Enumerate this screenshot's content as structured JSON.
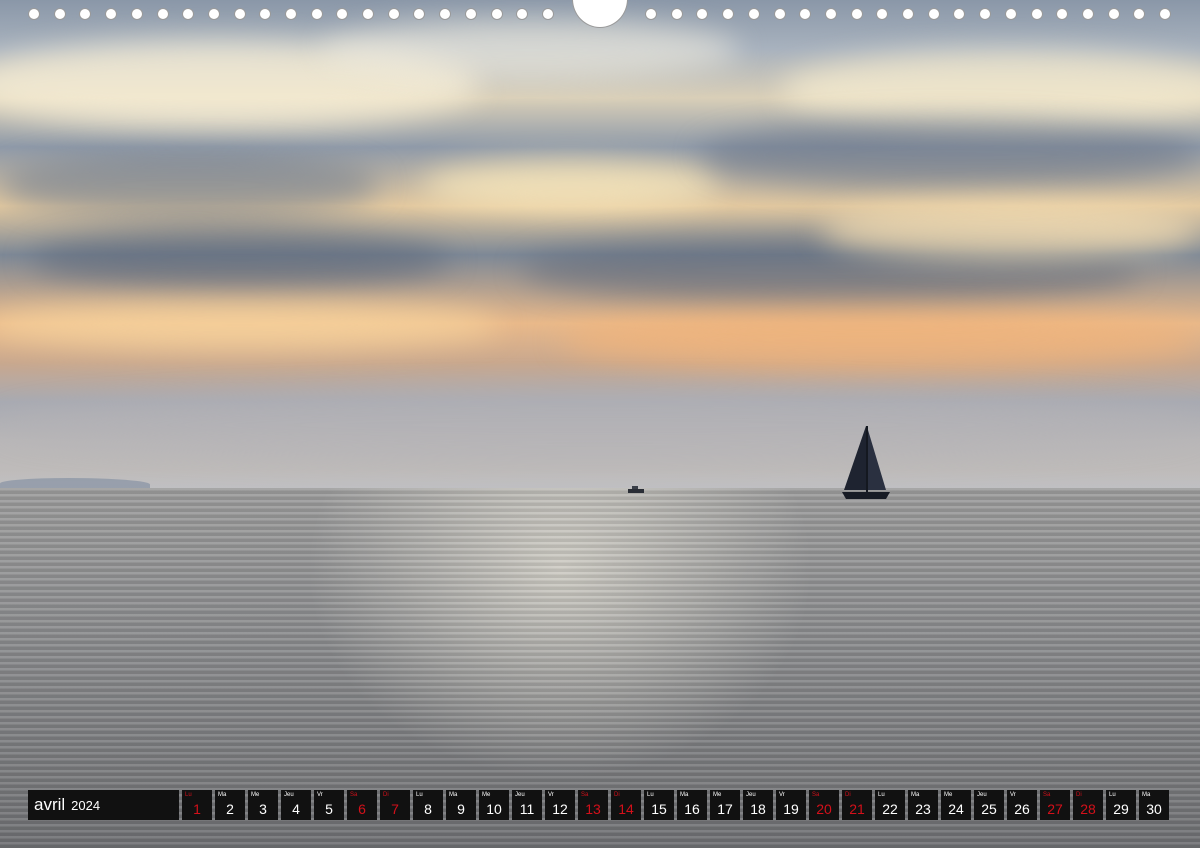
{
  "calendar": {
    "month": "avril",
    "year": "2024",
    "days": [
      {
        "abbr": "Lu",
        "num": "1",
        "red": true
      },
      {
        "abbr": "Ma",
        "num": "2",
        "red": false
      },
      {
        "abbr": "Me",
        "num": "3",
        "red": false
      },
      {
        "abbr": "Jeu",
        "num": "4",
        "red": false
      },
      {
        "abbr": "Vr",
        "num": "5",
        "red": false
      },
      {
        "abbr": "Sa",
        "num": "6",
        "red": true
      },
      {
        "abbr": "Di",
        "num": "7",
        "red": true
      },
      {
        "abbr": "Lu",
        "num": "8",
        "red": false
      },
      {
        "abbr": "Ma",
        "num": "9",
        "red": false
      },
      {
        "abbr": "Me",
        "num": "10",
        "red": false
      },
      {
        "abbr": "Jeu",
        "num": "11",
        "red": false
      },
      {
        "abbr": "Vr",
        "num": "12",
        "red": false
      },
      {
        "abbr": "Sa",
        "num": "13",
        "red": true
      },
      {
        "abbr": "Di",
        "num": "14",
        "red": true
      },
      {
        "abbr": "Lu",
        "num": "15",
        "red": false
      },
      {
        "abbr": "Ma",
        "num": "16",
        "red": false
      },
      {
        "abbr": "Me",
        "num": "17",
        "red": false
      },
      {
        "abbr": "Jeu",
        "num": "18",
        "red": false
      },
      {
        "abbr": "Vr",
        "num": "19",
        "red": false
      },
      {
        "abbr": "Sa",
        "num": "20",
        "red": true
      },
      {
        "abbr": "Di",
        "num": "21",
        "red": true
      },
      {
        "abbr": "Lu",
        "num": "22",
        "red": false
      },
      {
        "abbr": "Ma",
        "num": "23",
        "red": false
      },
      {
        "abbr": "Me",
        "num": "24",
        "red": false
      },
      {
        "abbr": "Jeu",
        "num": "25",
        "red": false
      },
      {
        "abbr": "Vr",
        "num": "26",
        "red": false
      },
      {
        "abbr": "Sa",
        "num": "27",
        "red": true
      },
      {
        "abbr": "Di",
        "num": "28",
        "red": true
      },
      {
        "abbr": "Lu",
        "num": "29",
        "red": false
      },
      {
        "abbr": "Ma",
        "num": "30",
        "red": false
      }
    ]
  },
  "colors": {
    "strip_background": "#111111",
    "weekend_text": "#d4101a",
    "weekday_text": "#ffffff"
  },
  "photo": {
    "icons": [
      "sailboat-icon",
      "motorboat-icon"
    ]
  }
}
